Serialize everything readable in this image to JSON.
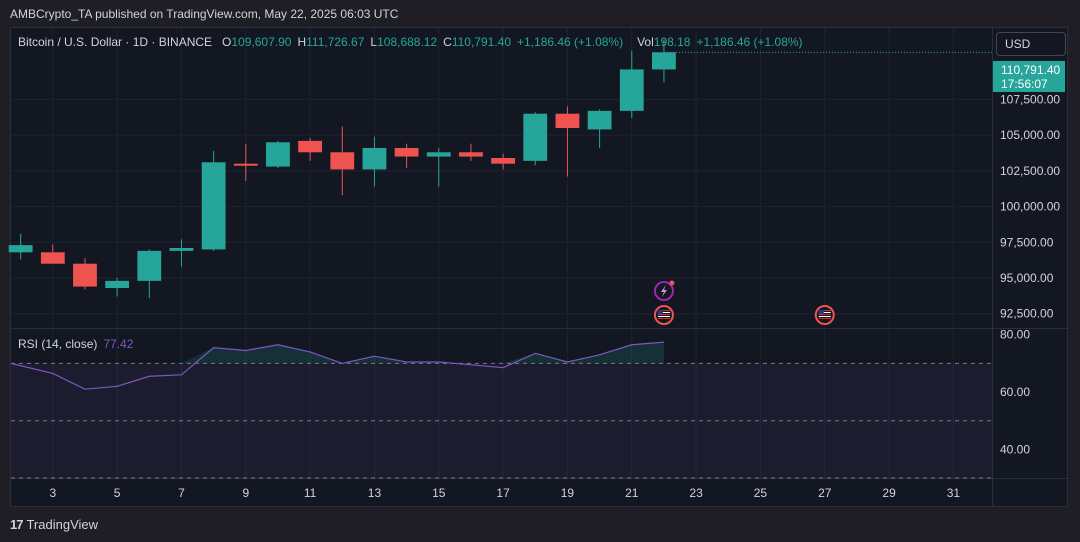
{
  "header": {
    "attribution": "AMBCrypto_TA published on TradingView.com, May 22, 2025 06:03 UTC"
  },
  "legend": {
    "symbol": "Bitcoin / U.S. Dollar · 1D · BINANCE",
    "o_label": "O",
    "o_value": "109,607.90",
    "h_label": "H",
    "h_value": "111,726.67",
    "l_label": "L",
    "l_value": "108,688.12",
    "c_label": "C",
    "c_value": "110,791.40",
    "change": "+1,186.46 (+1.08%)",
    "vol_label": "Vol",
    "vol_value": "198.18",
    "vol_change": "+1,186.46 (+1.08%)"
  },
  "currency": "USD",
  "last_price": {
    "price": "110,791.40",
    "countdown": "17:56:07"
  },
  "rsi_legend": {
    "label": "RSI (14, close)",
    "value": "77.42"
  },
  "brand": {
    "logo": "17",
    "name": "TradingView"
  },
  "colors": {
    "up": "#26a69a",
    "down": "#ef5350",
    "rsi": "#7e57c2",
    "bg": "#131722"
  },
  "chart_data": [
    {
      "type": "candlestick",
      "xlabel": "",
      "ylabel": "",
      "ylim": [
        91500,
        112500
      ],
      "y_ticks": [
        92500,
        95000,
        97500,
        100000,
        102500,
        105000,
        107500
      ],
      "y_tick_labels": [
        "92,500.00",
        "95,000.00",
        "97,500.00",
        "100,000.00",
        "102,500.00",
        "105,000.00",
        "107,500.00"
      ],
      "x_ticks": [
        3,
        5,
        7,
        9,
        11,
        13,
        15,
        17,
        19,
        21,
        23,
        25,
        27,
        29,
        31
      ],
      "x_tick_labels": [
        "3",
        "5",
        "7",
        "9",
        "11",
        "13",
        "15",
        "17",
        "19",
        "21",
        "23",
        "25",
        "27",
        "29",
        "31"
      ],
      "x_range": [
        1.7,
        32.2
      ],
      "candles": [
        {
          "day": 2,
          "o": 96800,
          "h": 98100,
          "l": 96300,
          "c": 97300
        },
        {
          "day": 3,
          "o": 96800,
          "h": 97350,
          "l": 96600,
          "c": 96000
        },
        {
          "day": 4,
          "o": 96000,
          "h": 96400,
          "l": 94200,
          "c": 94400
        },
        {
          "day": 5,
          "o": 94300,
          "h": 95000,
          "l": 93700,
          "c": 94800
        },
        {
          "day": 6,
          "o": 94800,
          "h": 97000,
          "l": 93600,
          "c": 96900
        },
        {
          "day": 7,
          "o": 96900,
          "h": 97700,
          "l": 95800,
          "c": 97100
        },
        {
          "day": 8,
          "o": 97000,
          "h": 103900,
          "l": 96900,
          "c": 103100
        },
        {
          "day": 9,
          "o": 103000,
          "h": 104400,
          "l": 101800,
          "c": 102900
        },
        {
          "day": 10,
          "o": 102800,
          "h": 104600,
          "l": 102700,
          "c": 104500
        },
        {
          "day": 11,
          "o": 104600,
          "h": 104800,
          "l": 103200,
          "c": 103800
        },
        {
          "day": 12,
          "o": 103800,
          "h": 105600,
          "l": 100800,
          "c": 102600
        },
        {
          "day": 13,
          "o": 102600,
          "h": 104900,
          "l": 101400,
          "c": 104100
        },
        {
          "day": 14,
          "o": 104100,
          "h": 104400,
          "l": 102700,
          "c": 103500
        },
        {
          "day": 15,
          "o": 103500,
          "h": 104100,
          "l": 101400,
          "c": 103800
        },
        {
          "day": 16,
          "o": 103800,
          "h": 104400,
          "l": 103200,
          "c": 103500
        },
        {
          "day": 17,
          "o": 103400,
          "h": 103700,
          "l": 102600,
          "c": 103000
        },
        {
          "day": 18,
          "o": 103200,
          "h": 106600,
          "l": 102900,
          "c": 106500
        },
        {
          "day": 19,
          "o": 106500,
          "h": 107000,
          "l": 102100,
          "c": 105500
        },
        {
          "day": 20,
          "o": 105400,
          "h": 106800,
          "l": 104100,
          "c": 106700
        },
        {
          "day": 21,
          "o": 106700,
          "h": 110900,
          "l": 106200,
          "c": 109600
        },
        {
          "day": 22,
          "o": 109600,
          "h": 111700,
          "l": 108700,
          "c": 110800
        }
      ],
      "last_price": 110791.4,
      "event_markers": [
        {
          "day": 22,
          "kind": "earnings-bolt"
        },
        {
          "day": 22,
          "kind": "us-flag"
        },
        {
          "day": 27,
          "kind": "us-flag"
        }
      ]
    },
    {
      "type": "line",
      "title": "RSI (14, close)",
      "ylim": [
        30,
        82
      ],
      "y_ticks": [
        40,
        60,
        80
      ],
      "y_tick_labels": [
        "40.00",
        "60.00",
        "80.00"
      ],
      "bands": {
        "upper": 70,
        "middle": 50,
        "lower": 30
      },
      "x": [
        2,
        3,
        4,
        5,
        6,
        7,
        8,
        9,
        10,
        11,
        12,
        13,
        14,
        15,
        16,
        17,
        18,
        19,
        20,
        21,
        22
      ],
      "values": [
        70,
        66.5,
        61,
        62,
        65.5,
        66,
        75.5,
        74.5,
        76.5,
        74,
        70,
        72.5,
        70.5,
        70.5,
        69.5,
        68.5,
        73.5,
        70.5,
        73,
        76.5,
        77.42
      ]
    }
  ]
}
